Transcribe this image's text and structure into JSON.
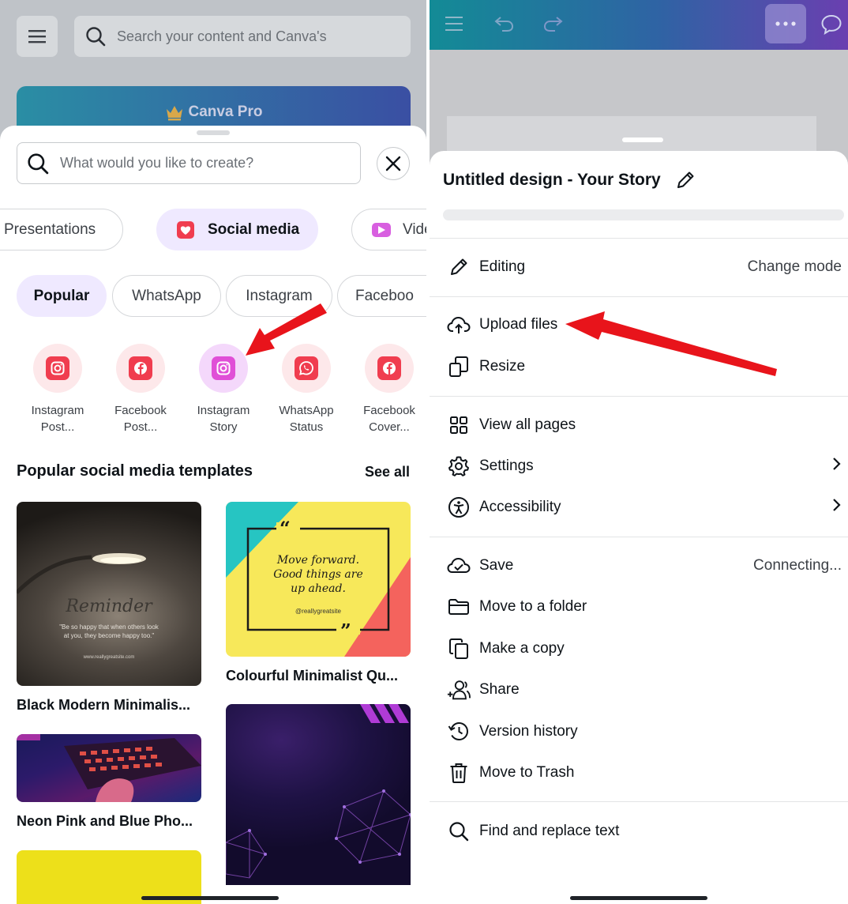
{
  "left": {
    "home": {
      "search_placeholder": "Search your content and Canva's",
      "pro_label": "Canva Pro"
    },
    "sheet": {
      "search_placeholder": "What would you like to create?",
      "categories": [
        "Presentations",
        "Social media",
        "Vide"
      ],
      "subcategories": [
        "Popular",
        "WhatsApp",
        "Instagram",
        "Faceboo"
      ],
      "formats": [
        {
          "line1": "Instagram",
          "line2": "Post...",
          "icon": "instagram-icon"
        },
        {
          "line1": "Facebook",
          "line2": "Post...",
          "icon": "facebook-icon"
        },
        {
          "line1": "Instagram",
          "line2": "Story",
          "icon": "instagram-icon"
        },
        {
          "line1": "WhatsApp",
          "line2": "Status",
          "icon": "whatsapp-icon"
        },
        {
          "line1": "Facebook",
          "line2": "Cover...",
          "icon": "facebook-icon"
        }
      ],
      "section_title": "Popular social media templates",
      "see_all": "See all",
      "templates": [
        {
          "caption": "Black Modern Minimalis...",
          "script_text": "Reminder",
          "body_text": "\"Be so happy that when others look at you, they become happy too.\"",
          "site_text": "www.reallygreatsite.com"
        },
        {
          "caption": "Colourful Minimalist Qu...",
          "quote": "Move forward. Good things are up ahead.",
          "handle": "@reallygreatsite"
        },
        {
          "caption": "Neon Pink and Blue Pho..."
        }
      ]
    }
  },
  "right": {
    "title": "Untitled design - Your Story",
    "menu": [
      {
        "label": "Editing",
        "right": "Change mode",
        "icon": "pencil-icon"
      },
      {
        "label": "Upload files",
        "right": "",
        "icon": "cloud-upload-icon"
      },
      {
        "label": "Resize",
        "right": "",
        "icon": "resize-icon"
      },
      {
        "label": "View all pages",
        "right": "",
        "icon": "grid-icon"
      },
      {
        "label": "Settings",
        "right": "",
        "icon": "gear-icon"
      },
      {
        "label": "Accessibility",
        "right": "",
        "icon": "accessibility-icon"
      },
      {
        "label": "Save",
        "right": "Connecting...",
        "icon": "cloud-check-icon"
      },
      {
        "label": "Move to a folder",
        "right": "",
        "icon": "folder-icon"
      },
      {
        "label": "Make a copy",
        "right": "",
        "icon": "copy-icon"
      },
      {
        "label": "Share",
        "right": "",
        "icon": "share-people-icon"
      },
      {
        "label": "Version history",
        "right": "",
        "icon": "history-icon"
      },
      {
        "label": "Move to Trash",
        "right": "",
        "icon": "trash-icon"
      },
      {
        "label": "Find and replace text",
        "right": "",
        "icon": "search-icon"
      }
    ]
  },
  "colors": {
    "accent_pill": "#efe9ff",
    "annotation_arrow": "#e8141b",
    "social_red": "#f03d4f",
    "instagram_story": "#e04fd7"
  }
}
